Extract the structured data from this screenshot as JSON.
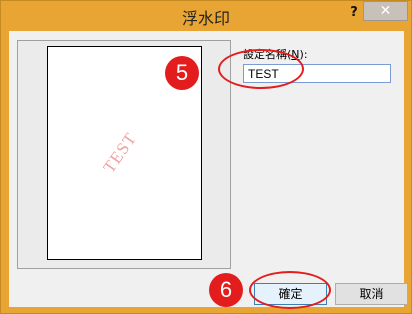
{
  "window": {
    "title": "浮水印",
    "help_label": "?",
    "close_label": "✕"
  },
  "preview": {
    "watermark_text": "TEST"
  },
  "form": {
    "field_label_prefix": "設定名稱(",
    "field_label_key": "N",
    "field_label_suffix": "):",
    "field_value": "TEST"
  },
  "buttons": {
    "ok_label": "確定",
    "cancel_label": "取消"
  },
  "annotations": {
    "step_5": "5",
    "step_6": "6",
    "marker_color": "#e31d1d"
  }
}
